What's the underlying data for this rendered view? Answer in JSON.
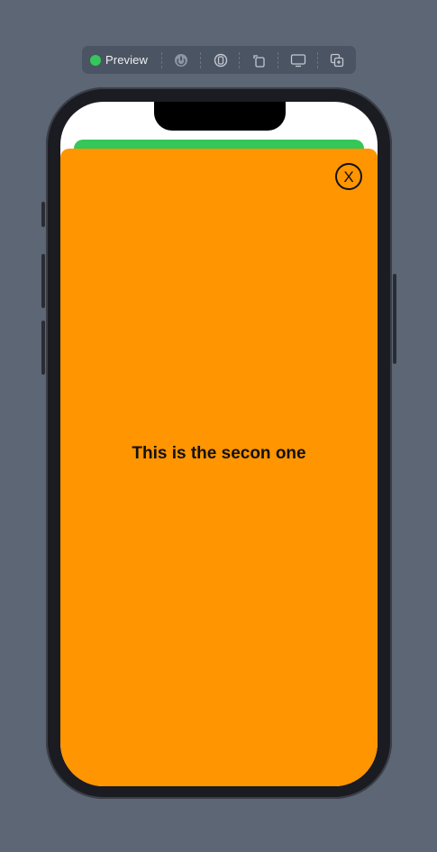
{
  "toolbar": {
    "preview_label": "Preview",
    "status_color": "#34c759",
    "icons": [
      "live-preview-icon",
      "variants-icon",
      "rotate-device-icon",
      "device-settings-icon",
      "duplicate-preview-icon"
    ]
  },
  "colors": {
    "background": "#5c6675",
    "green_sheet": "#34c759",
    "orange_sheet": "#ff9500",
    "text": "#111111"
  },
  "sheet": {
    "close_glyph": "X",
    "message": "This is the secon one"
  }
}
